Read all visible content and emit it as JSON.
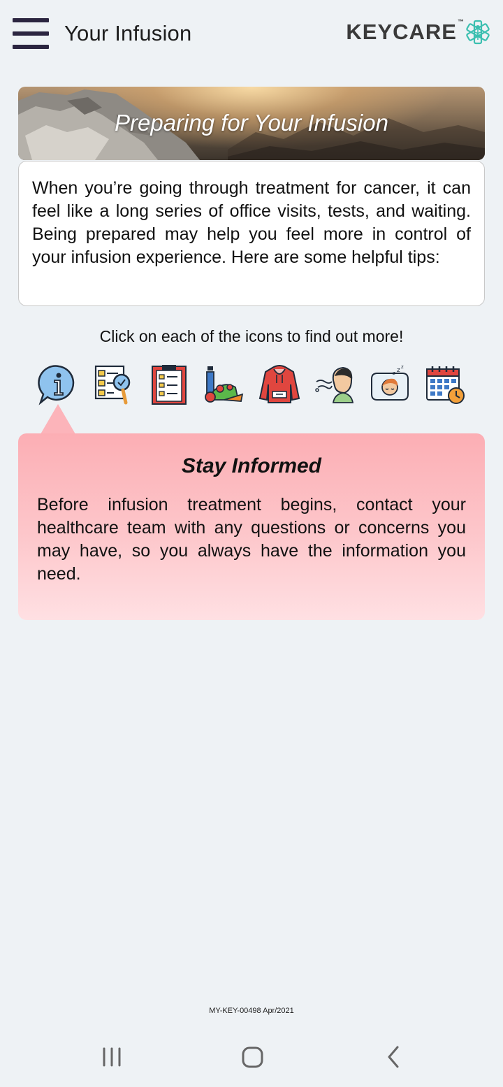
{
  "header": {
    "title": "Your Infusion",
    "logo_text": "KEYCARE",
    "logo_tm": "™",
    "menu_icon": "hamburger-menu-icon",
    "logo_mark_icon": "caduceus-star-icon"
  },
  "banner": {
    "title": "Preparing for Your Infusion"
  },
  "intro": {
    "text": "When you’re going through treatment for cancer, it can feel like a long series of office visits, tests, and waiting. Being prepared may help you feel more in control of your infusion experience. Here are some helpful tips:"
  },
  "instruction": "Click on each of the icons to find out more!",
  "tips": [
    {
      "icon": "info-speech-bubble-icon",
      "selected": true
    },
    {
      "icon": "checklist-magnifier-icon",
      "selected": false
    },
    {
      "icon": "clipboard-checklist-icon",
      "selected": false
    },
    {
      "icon": "healthy-food-bottle-icon",
      "selected": false
    },
    {
      "icon": "hoodie-icon",
      "selected": false
    },
    {
      "icon": "breathing-person-icon",
      "selected": false
    },
    {
      "icon": "sleeping-person-icon",
      "selected": false
    },
    {
      "icon": "calendar-clock-icon",
      "selected": false
    }
  ],
  "info_panel": {
    "title": "Stay Informed",
    "body": "Before infusion treatment begins, contact your healthcare team with any questions or concerns you may have, so you always have the information you need."
  },
  "footer_code": "MY-KEY-00498 Apr/2021",
  "colors": {
    "background": "#eef2f5",
    "panel_pink": "#fcb4ba",
    "logo_teal": "#3bbfb0",
    "menu_dark": "#2b2540"
  },
  "navbar": {
    "recents_icon": "recent-apps-icon",
    "home_icon": "home-icon",
    "back_icon": "back-icon"
  }
}
